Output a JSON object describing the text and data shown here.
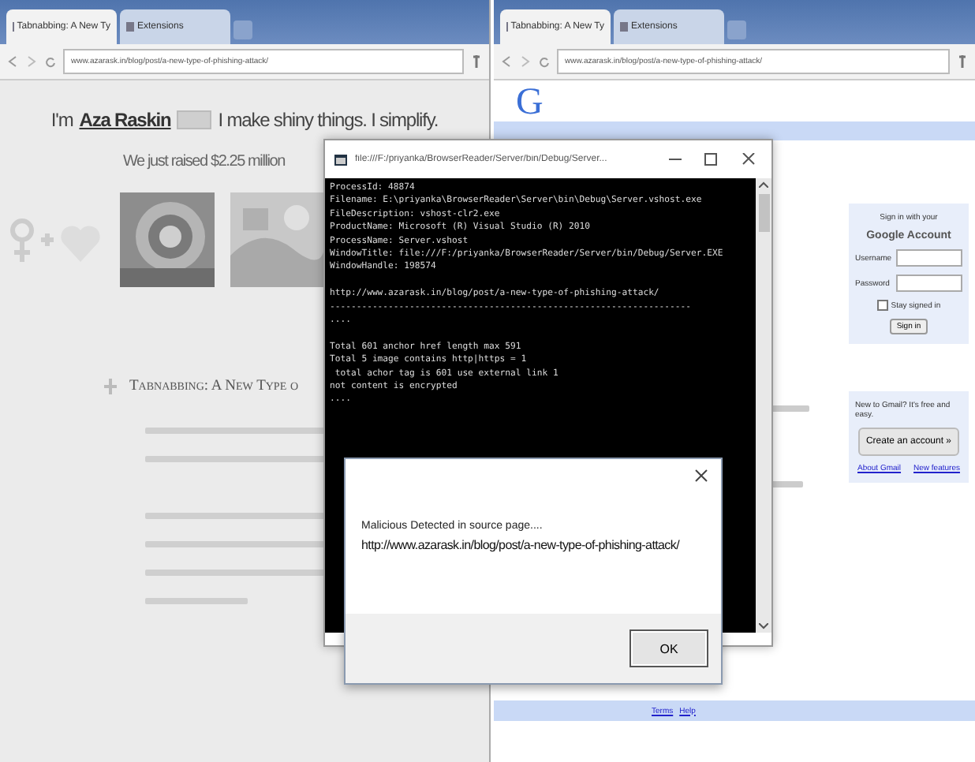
{
  "left_browser": {
    "tabs": [
      {
        "title": "Tabnabbing: A New Ty",
        "selected": true
      },
      {
        "title": "Extensions",
        "selected": false
      }
    ],
    "address": "www.azarask.in/blog/post/a-new-type-of-phishing-attack/",
    "page": {
      "intro_before": "I'm",
      "author": "Aza Raskin",
      "intro_after": "I make shiny things. I simplify.",
      "raised": "We just raised $2.25 million",
      "post_title": "Tabnabbing: A New Type o"
    }
  },
  "right_browser": {
    "tabs": [
      {
        "title": "Tabnabbing: A New Ty",
        "selected": true
      },
      {
        "title": "Extensions",
        "selected": false
      }
    ],
    "address": "www.azarask.in/blog/post/a-new-type-of-phishing-attack/",
    "logo": "G",
    "sign_in": {
      "heading": "Sign in with your",
      "account": "Google Account",
      "username_label": "Username",
      "password_label": "Password",
      "stay_signed_in": "Stay signed in",
      "stay_checked": false,
      "button": "Sign in"
    },
    "signup": {
      "prompt": "New to Gmail? It's free and easy.",
      "button": "Create an account »",
      "links": [
        "About Gmail",
        "New features"
      ]
    },
    "footer_links": [
      "Terms",
      "Help"
    ]
  },
  "console_window": {
    "title": "file:///F:/priyanka/BrowserReader/Server/bin/Debug/Server...",
    "lines": [
      {
        "text": "ProcessId: 48874",
        "blank_before": false
      },
      {
        "text": "Filename: E:\\priyanka\\BrowserReader\\Server\\bin\\Debug\\Server.vshost.exe",
        "blank_before": false
      },
      {
        "text": "FileDescription: vshost-clr2.exe",
        "blank_before": false
      },
      {
        "text": "ProductName: Microsoft (R) Visual Studio (R) 2010",
        "blank_before": false
      },
      {
        "text": "ProcessName: Server.vshost",
        "blank_before": false
      },
      {
        "text": "WindowTitle: file:///F:/priyanka/BrowserReader/Server/bin/Debug/Server.EXE",
        "blank_before": false
      },
      {
        "text": "WindowHandle: 198574",
        "blank_before": false
      },
      {
        "text": "http://www.azarask.in/blog/post/a-new-type-of-phishing-attack/",
        "blank_before": true
      },
      {
        "text": "--------------------------------------------------------------------",
        "blank_before": false
      },
      {
        "text": "....",
        "blank_before": false
      },
      {
        "text": "Total 601 anchor href length max 591",
        "blank_before": true
      },
      {
        "text": "Total 5 image contains http|https = 1",
        "blank_before": false
      },
      {
        "text": " total achor tag is 601 use external link 1",
        "blank_before": false
      },
      {
        "text": "not content is encrypted",
        "blank_before": false
      },
      {
        "text": "....",
        "blank_before": false
      }
    ]
  },
  "message_box": {
    "message": "Malicious Detected in source page....",
    "url": "http://www.azarask.in/blog/post/a-new-type-of-phishing-attack/",
    "button": "OK"
  }
}
